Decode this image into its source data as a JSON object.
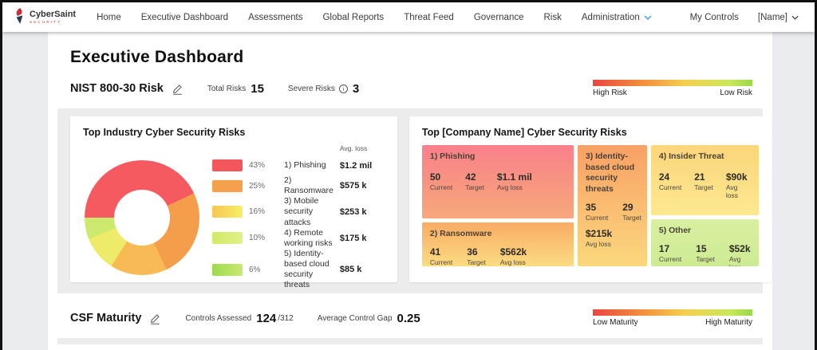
{
  "nav": {
    "logo_title": "CyberSaint",
    "logo_subtitle": "SECURITY",
    "items": [
      "Home",
      "Executive Dashboard",
      "Assessments",
      "Global Reports",
      "Threat Feed",
      "Governance",
      "Risk",
      "Administration"
    ],
    "my_controls": "My Controls",
    "user": "[Name]"
  },
  "page_title": "Executive Dashboard",
  "nist": {
    "title": "NIST 800-30 Risk",
    "total_label": "Total Risks",
    "total_value": "15",
    "severe_label": "Severe Risks",
    "severe_value": "3",
    "scale_left": "High Risk",
    "scale_right": "Low Risk"
  },
  "industry_card": {
    "title": "Top Industry Cyber Security Risks",
    "avg_loss_header": "Avg. loss",
    "rows": [
      {
        "pct": "43%",
        "label": "1) Phishing",
        "value": "$1.2 mil"
      },
      {
        "pct": "25%",
        "label": "2) Ransomware",
        "value": "$575 k"
      },
      {
        "pct": "16%",
        "label": "3) Mobile security attacks",
        "value": "$253 k"
      },
      {
        "pct": "10%",
        "label": "4) Remote working risks",
        "value": "$175 k"
      },
      {
        "pct": "6%",
        "label": "5) Identity-based cloud security threats",
        "value": "$85 k"
      }
    ]
  },
  "company_card": {
    "title": "Top [Company Name] Cyber Security Risks",
    "labels": {
      "current": "Current",
      "target": "Target",
      "avg_loss": "Avg loss"
    },
    "blocks": [
      {
        "name": "1) Phishing",
        "current": "50",
        "target": "42",
        "avg_loss": "$1.1 mil"
      },
      {
        "name": "2) Ransomware",
        "current": "41",
        "target": "36",
        "avg_loss": "$562k"
      },
      {
        "name": "3) Identity-based cloud security threats",
        "current": "35",
        "target": "29",
        "avg_loss": "$215k"
      },
      {
        "name": "4) Insider Threat",
        "current": "24",
        "target": "21",
        "avg_loss": "$90k"
      },
      {
        "name": "5) Other",
        "current": "17",
        "target": "15",
        "avg_loss": "$52k"
      }
    ]
  },
  "csf": {
    "title": "CSF Maturity",
    "assessed_label": "Controls Assessed",
    "assessed_value": "124",
    "assessed_total": "/312",
    "gap_label": "Average Control Gap",
    "gap_value": "0.25",
    "scale_left": "Low Maturity",
    "scale_right": "High Maturity"
  },
  "colors": {
    "accent_blue": "#2e9fe6",
    "brand_red": "#c5303c",
    "risk_scale_gradient": [
      "#e9453e",
      "#f0883e",
      "#f6cf4d",
      "#99d94b"
    ]
  },
  "chart_data": [
    {
      "type": "pie",
      "title": "Top Industry Cyber Security Risks",
      "labels": [
        "1) Phishing",
        "2) Ransomware",
        "3) Mobile security attacks",
        "4) Remote working risks",
        "5) Identity-based cloud security threats"
      ],
      "values": [
        43,
        25,
        16,
        10,
        6
      ],
      "avg_loss": [
        "$1.2 mil",
        "$575 k",
        "$253 k",
        "$175 k",
        "$85 k"
      ],
      "colors": [
        "#f4565e",
        "#f5a04b",
        "#f8ba55",
        "#d9ee74",
        "#a9dd55"
      ],
      "donut": true,
      "start_angle_cw_from_top_deg": 270,
      "legend_position": "right"
    },
    {
      "type": "treemap",
      "title": "Top [Company Name] Cyber Security Risks",
      "series": [
        {
          "name": "1) Phishing",
          "current": 50,
          "target": 42,
          "avg_loss": "$1.1 mil",
          "color": "#f9808a"
        },
        {
          "name": "2) Ransomware",
          "current": 41,
          "target": 36,
          "avg_loss": "$562k",
          "color": "#f9ab64"
        },
        {
          "name": "3) Identity-based cloud security threats",
          "current": 35,
          "target": 29,
          "avg_loss": "$215k",
          "color": "#f8a065"
        },
        {
          "name": "4) Insider Threat",
          "current": 24,
          "target": 21,
          "avg_loss": "$90k",
          "color": "#fbd57a"
        },
        {
          "name": "5) Other",
          "current": 17,
          "target": 15,
          "avg_loss": "$52k",
          "color": "#d3ed9a"
        }
      ]
    }
  ]
}
